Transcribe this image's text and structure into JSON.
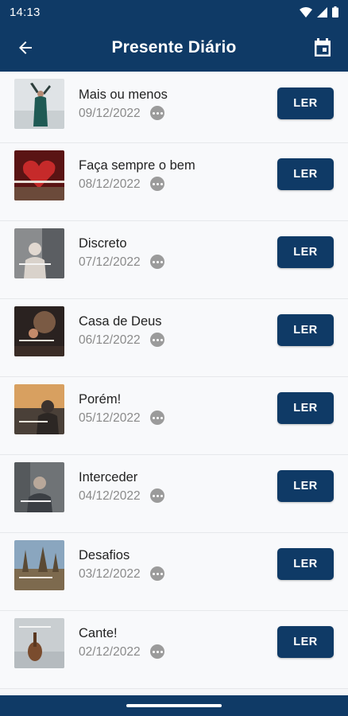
{
  "status_bar": {
    "time": "14:13"
  },
  "app_bar": {
    "title": "Presente Diário"
  },
  "items": [
    {
      "title": "Mais ou menos",
      "date": "09/12/2022",
      "button": "LER"
    },
    {
      "title": "Faça sempre o bem",
      "date": "08/12/2022",
      "button": "LER"
    },
    {
      "title": "Discreto",
      "date": "07/12/2022",
      "button": "LER"
    },
    {
      "title": "Casa de Deus",
      "date": "06/12/2022",
      "button": "LER"
    },
    {
      "title": "Porém!",
      "date": "05/12/2022",
      "button": "LER"
    },
    {
      "title": "Interceder",
      "date": "04/12/2022",
      "button": "LER"
    },
    {
      "title": "Desafios",
      "date": "03/12/2022",
      "button": "LER"
    },
    {
      "title": "Cante!",
      "date": "02/12/2022",
      "button": "LER"
    }
  ],
  "colors": {
    "brand": "#0f3a66",
    "background": "#f5f6f8",
    "muted_text": "#8a8a8a"
  }
}
